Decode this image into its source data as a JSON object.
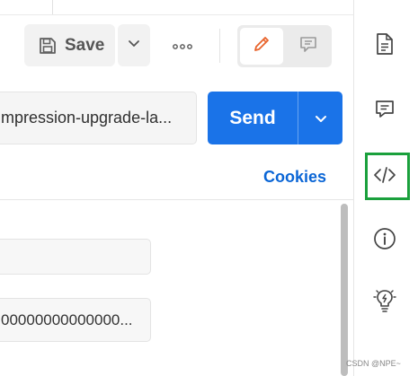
{
  "toolbar": {
    "save_label": "Save"
  },
  "request": {
    "url_text": "mpression-upgrade-la...",
    "send_label": "Send"
  },
  "cookies_label": "Cookies",
  "params": [
    {
      "value": ""
    },
    {
      "value": "00000000000000..."
    }
  ],
  "sidebar": {
    "items": [
      {
        "icon": "document-icon"
      },
      {
        "icon": "comment-icon"
      },
      {
        "icon": "code-icon",
        "highlighted": true
      },
      {
        "icon": "info-icon"
      },
      {
        "icon": "lightbulb-icon"
      }
    ]
  },
  "colors": {
    "send_button": "#1a73e8",
    "link": "#0b66d6",
    "edit_pencil": "#e8632b",
    "highlight_box": "#1aa03c"
  },
  "watermark": "CSDN @NPE~"
}
